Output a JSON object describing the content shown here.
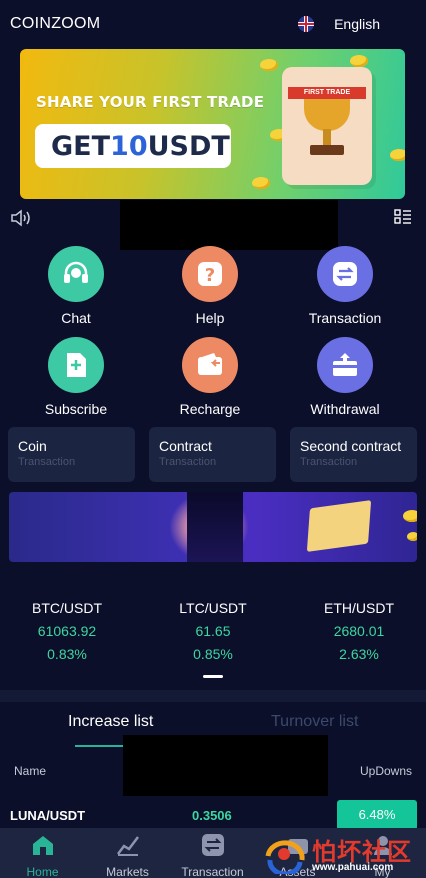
{
  "header": {
    "brand": "COINZOOM",
    "language": "English"
  },
  "banner": {
    "line1": "SHARE YOUR FIRST TRADE",
    "cta_prefix": "GET ",
    "cta_amount": "10",
    "cta_suffix": "USDT",
    "ribbon": "FIRST TRADE"
  },
  "shortcuts": [
    {
      "label": "Chat",
      "color": "#3ec9a5",
      "icon": "headset-icon"
    },
    {
      "label": "Help",
      "color": "#ee8a63",
      "icon": "question-icon"
    },
    {
      "label": "Transaction",
      "color": "#6b6fe4",
      "icon": "swap-icon"
    },
    {
      "label": "Subscribe",
      "color": "#3ec9a5",
      "icon": "document-plus-icon"
    },
    {
      "label": "Recharge",
      "color": "#ee8a63",
      "icon": "wallet-icon"
    },
    {
      "label": "Withdrawal",
      "color": "#6b6fe4",
      "icon": "card-upload-icon"
    }
  ],
  "cards": [
    {
      "title": "Coin",
      "sub": "Transaction"
    },
    {
      "title": "Contract",
      "sub": "Transaction"
    },
    {
      "title": "Second contract",
      "sub": "Transaction"
    }
  ],
  "tickers": [
    {
      "pair": "BTC/USDT",
      "price": "61063.92",
      "change": "0.83%"
    },
    {
      "pair": "LTC/USDT",
      "price": "61.65",
      "change": "0.85%"
    },
    {
      "pair": "ETH/USDT",
      "price": "2680.01",
      "change": "2.63%"
    }
  ],
  "list_tabs": {
    "active": "Increase list",
    "inactive": "Turnover list"
  },
  "columns": {
    "name": "Name",
    "updowns": "UpDowns"
  },
  "rows": [
    {
      "pair": "LUNA/USDT",
      "price": "0.3506",
      "change": "6.48%"
    }
  ],
  "nav": [
    {
      "label": "Home",
      "icon": "home-icon"
    },
    {
      "label": "Markets",
      "icon": "chart-icon"
    },
    {
      "label": "Transaction",
      "icon": "swap-icon"
    },
    {
      "label": "Assets",
      "icon": "wallet-icon"
    },
    {
      "label": "My",
      "icon": "user-icon"
    }
  ],
  "watermark": {
    "text": "怕坏社区",
    "url": "www.pahuai.com"
  },
  "colors": {
    "accent": "#2ab497",
    "up": "#3ed6a0",
    "background": "#0b0f2a"
  }
}
